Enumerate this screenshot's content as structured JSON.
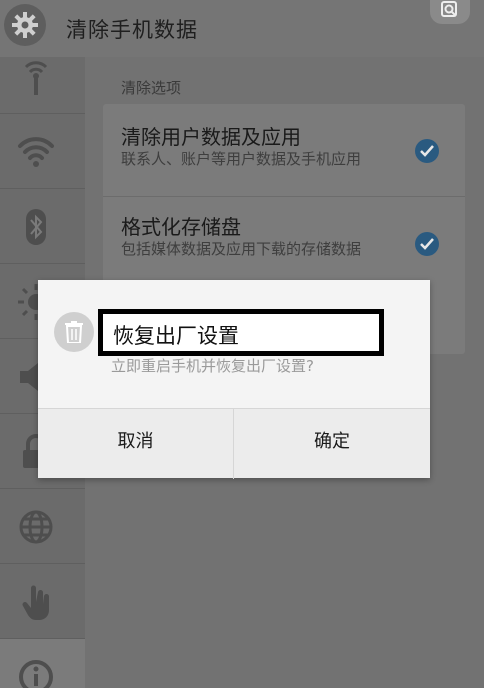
{
  "titlebar": {
    "title": "清除手机数据",
    "settings_icon": "gear-icon",
    "search_icon": "search-icon"
  },
  "rail": {
    "items": [
      {
        "icon": "wireless-antenna-icon"
      },
      {
        "icon": "wifi-icon"
      },
      {
        "icon": "bluetooth-icon"
      },
      {
        "icon": "brightness-icon"
      },
      {
        "icon": "volume-icon"
      },
      {
        "icon": "lock-icon"
      },
      {
        "icon": "globe-icon"
      },
      {
        "icon": "hand-gesture-icon"
      },
      {
        "icon": "info-icon"
      }
    ]
  },
  "main": {
    "section_label": "清除选项",
    "options": [
      {
        "title": "清除用户数据及应用",
        "subtitle": "联系人、账户等用户数据及手机应用",
        "checked": true
      },
      {
        "title": "格式化存储盘",
        "subtitle": "包括媒体数据及应用下载的存储数据",
        "checked": true
      }
    ]
  },
  "dialog": {
    "icon": "trash-icon",
    "title": "恢复出厂设置",
    "message": "立即重启手机并恢复出厂设置?",
    "cancel_label": "取消",
    "confirm_label": "确定"
  },
  "colors": {
    "checkbox": "#2a5a80",
    "dialog_bg": "#f4f4f4",
    "highlight_border": "#000000"
  }
}
